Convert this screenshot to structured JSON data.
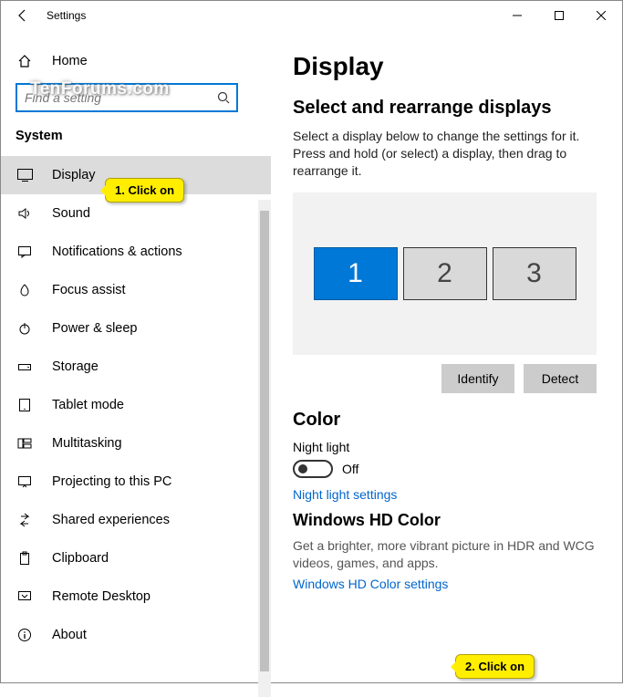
{
  "titlebar": {
    "title": "Settings"
  },
  "watermark": "TenForums.com",
  "sidebar": {
    "home": "Home",
    "search_placeholder": "Find a setting",
    "section": "System",
    "items": [
      {
        "label": "Display"
      },
      {
        "label": "Sound"
      },
      {
        "label": "Notifications & actions"
      },
      {
        "label": "Focus assist"
      },
      {
        "label": "Power & sleep"
      },
      {
        "label": "Storage"
      },
      {
        "label": "Tablet mode"
      },
      {
        "label": "Multitasking"
      },
      {
        "label": "Projecting to this PC"
      },
      {
        "label": "Shared experiences"
      },
      {
        "label": "Clipboard"
      },
      {
        "label": "Remote Desktop"
      },
      {
        "label": "About"
      }
    ]
  },
  "main": {
    "heading": "Display",
    "rearrange": {
      "title": "Select and rearrange displays",
      "desc": "Select a display below to change the settings for it. Press and hold (or select) a display, then drag to rearrange it.",
      "monitors": [
        "1",
        "2",
        "3"
      ],
      "identify": "Identify",
      "detect": "Detect"
    },
    "color": {
      "title": "Color",
      "nightlight_label": "Night light",
      "nightlight_state": "Off",
      "nightlight_link": "Night light settings"
    },
    "hdcolor": {
      "title": "Windows HD Color",
      "desc": "Get a brighter, more vibrant picture in HDR and WCG videos, games, and apps.",
      "link": "Windows HD Color settings"
    }
  },
  "callouts": {
    "c1": "1. Click on",
    "c2": "2. Click on"
  }
}
